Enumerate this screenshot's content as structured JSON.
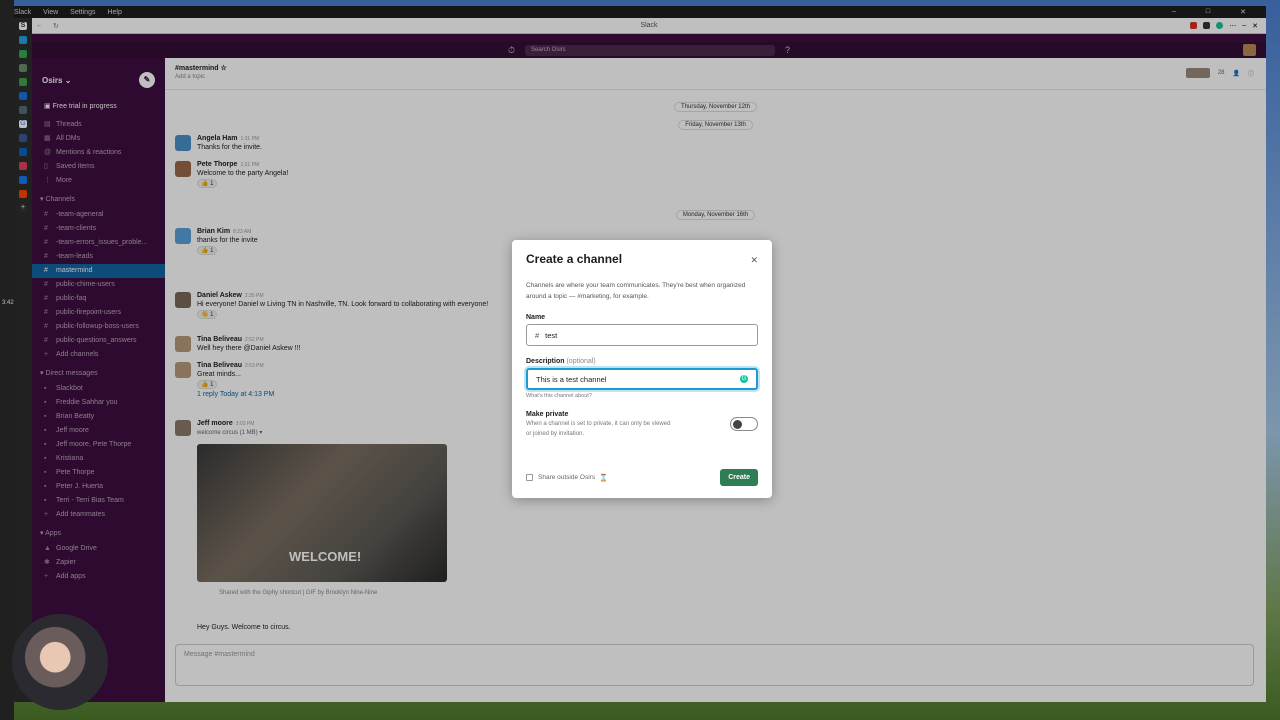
{
  "os": {
    "menus": [
      "Slack",
      "View",
      "Settings",
      "Help"
    ],
    "clock": "3:42"
  },
  "browser": {
    "title": "Slack"
  },
  "topbar": {
    "search_placeholder": "Search Osirs"
  },
  "sidebar": {
    "workspace": "Osirs",
    "trial": "Free trial in progress",
    "nav": [
      {
        "label": "Threads",
        "icon": "threads-icon"
      },
      {
        "label": "All DMs",
        "icon": "dm-icon"
      },
      {
        "label": "Mentions & reactions",
        "icon": "at-icon"
      },
      {
        "label": "Saved items",
        "icon": "bookmark-icon"
      },
      {
        "label": "More",
        "icon": "more-icon"
      }
    ],
    "channels_header": "Channels",
    "channels": [
      {
        "label": "-team-ageneral",
        "active": false
      },
      {
        "label": "-team-clients",
        "active": false
      },
      {
        "label": "-team-errors_issues_proble...",
        "active": false
      },
      {
        "label": "-team-leads",
        "active": false
      },
      {
        "label": "mastermind",
        "active": true
      },
      {
        "label": "public-chime-users",
        "active": false
      },
      {
        "label": "public-faq",
        "active": false
      },
      {
        "label": "public-firepoint-users",
        "active": false
      },
      {
        "label": "public-followup-boss-users",
        "active": false
      },
      {
        "label": "public-questions_answers",
        "active": false
      }
    ],
    "add_channels": "Add channels",
    "dm_header": "Direct messages",
    "dms": [
      "Slackbot",
      "Freddie Sahhar  you",
      "Brian Beatty",
      "Jeff moore",
      "Jeff moore, Pete Thorpe",
      "Kristiana",
      "Pete Thorpe",
      "Peter J. Huerta",
      "Terri - Terri Bias Team"
    ],
    "add_teammates": "Add teammates",
    "apps_header": "Apps",
    "apps": [
      "Google Drive",
      "Zapier"
    ],
    "add_apps": "Add apps"
  },
  "channel": {
    "name": "#mastermind",
    "topic": "Add a topic",
    "member_count": "28"
  },
  "messages": {
    "days": [
      "Thursday, November 12th",
      "Friday, November 13th",
      "Monday, November 16th"
    ],
    "items": [
      {
        "name": "Angela Ham",
        "time": "1:31 PM",
        "text": "Thanks for the invite."
      },
      {
        "name": "Pete Thorpe",
        "time": "1:31 PM",
        "text": "Welcome to the party Angela!",
        "reaction": "👍 1"
      },
      {
        "name": "Brian Kim",
        "time": "8:23 AM",
        "text": "thanks for the invite",
        "reaction": "👍 1"
      },
      {
        "name": "Daniel Askew",
        "time": "2:35 PM",
        "text": "Hi everyone! Daniel w Living TN in Nashville, TN. Look forward to collaborating with everyone!",
        "reaction": "👋 1"
      },
      {
        "name": "Tina Beliveau",
        "time": "2:52 PM",
        "text": "Well hey there @Daniel Askew !!!"
      },
      {
        "name": "Tina Beliveau",
        "time": "2:53 PM",
        "text": "Great minds...",
        "reaction": "👍 1"
      },
      {
        "name": "Jeff moore",
        "time": "3:03 PM",
        "text": "welcome circus (1 MB) ▾"
      }
    ],
    "thread_reply": "1 reply  Today at 4:13 PM",
    "gif_caption": "WELCOME!",
    "giphy_note": "Shared with the Giphy shortcut | GIF by Brooklyn Nine-Nine",
    "last_text": "Hey Guys. Welcome to circus."
  },
  "composer": {
    "placeholder": "Message #mastermind"
  },
  "modal": {
    "title": "Create a channel",
    "intro": "Channels are where your team communicates. They're best when organized around a topic — #marketing, for example.",
    "name_label": "Name",
    "name_value": "test",
    "desc_label": "Description",
    "desc_optional": "(optional)",
    "desc_value": "This is a test channel",
    "desc_hint": "What's this channel about?",
    "private_title": "Make private",
    "private_desc": "When a channel is set to private, it can only be viewed or joined by invitation.",
    "private_on": false,
    "share_label": "Share outside Osirs",
    "create_label": "Create",
    "accent": "#2f7d55"
  }
}
